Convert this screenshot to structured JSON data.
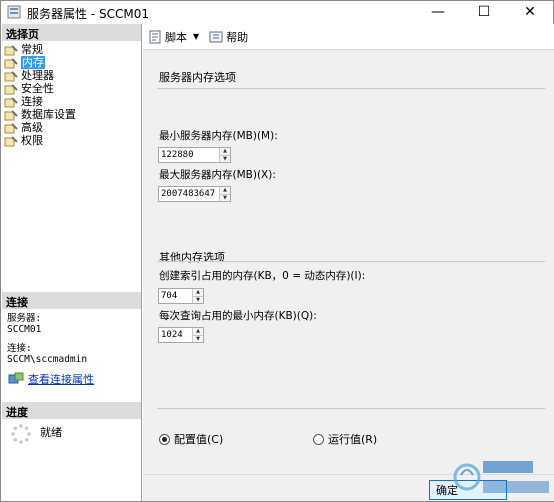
{
  "window": {
    "title": "服务器属性 - SCCM01",
    "min_glyph": "—",
    "max_glyph": "☐",
    "close_glyph": "✕"
  },
  "left": {
    "select_page_header": "选择页",
    "nav_items": [
      {
        "label": "常规",
        "selected": false
      },
      {
        "label": "内存",
        "selected": true
      },
      {
        "label": "处理器",
        "selected": false
      },
      {
        "label": "安全性",
        "selected": false
      },
      {
        "label": "连接",
        "selected": false
      },
      {
        "label": "数据库设置",
        "selected": false
      },
      {
        "label": "高级",
        "selected": false
      },
      {
        "label": "权限",
        "selected": false
      }
    ],
    "connection_header": "连接",
    "server_label": "服务器:",
    "server_value": "SCCM01",
    "connection_label": "连接:",
    "connection_value": "SCCM\\sccmadmin",
    "view_conn_props": "查看连接属性",
    "progress_header": "进度",
    "progress_status": "就绪"
  },
  "toolbar": {
    "script_label": "脚本",
    "help_label": "帮助"
  },
  "memory": {
    "section_title": "服务器内存选项",
    "min_label": "最小服务器内存(MB)(M):",
    "min_value": "122880",
    "max_label": "最大服务器内存(MB)(X):",
    "max_value": "2007483647"
  },
  "other": {
    "section_title": "其他内存选项",
    "index_label": "创建索引占用的内存(KB，0 = 动态内存)(I):",
    "index_value": "704",
    "query_label": "每次查询占用的最小内存(KB)(Q):",
    "query_value": "1024"
  },
  "radios": {
    "configured_label": "配置值(C)",
    "configured_selected": true,
    "running_label": "运行值(R)",
    "running_selected": false
  },
  "footer": {
    "ok_label": "确定"
  },
  "colors": {
    "selection": "#3399ff",
    "link": "#0033cc",
    "header_bg": "#dcdcdc",
    "panel_bg": "#f0f0f0"
  }
}
